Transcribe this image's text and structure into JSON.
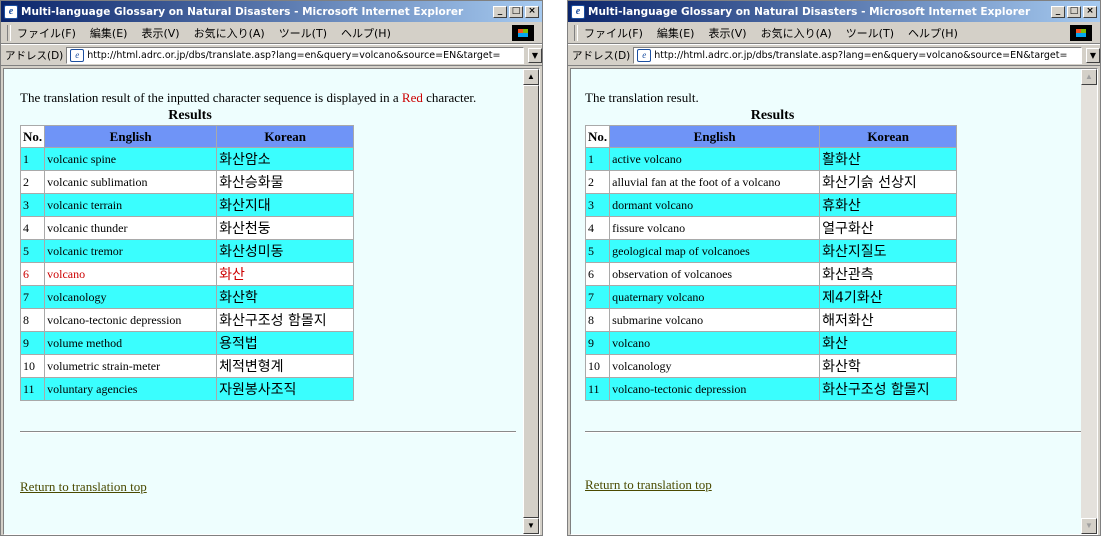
{
  "windows": [
    {
      "title": "Multi-language Glossary on Natural Disasters - Microsoft Internet Explorer",
      "menu": [
        "ファイル(F)",
        "編集(E)",
        "表示(V)",
        "お気に入り(A)",
        "ツール(T)",
        "ヘルプ(H)"
      ],
      "address_label": "アドレス(D)",
      "url": "http://html.adrc.or.jp/dbs/translate.asp?lang=en&query=volcano&source=EN&target=",
      "intro_before": "The translation result of the inputted character sequence is displayed in a ",
      "intro_red": "Red",
      "intro_after": " character.",
      "results_title": "Results",
      "headers": [
        "No.",
        "English",
        "Korean"
      ],
      "rows": [
        {
          "no": "1",
          "english": "volcanic spine",
          "korean": "화산암소"
        },
        {
          "no": "2",
          "english": "volcanic sublimation",
          "korean": "화산승화물"
        },
        {
          "no": "3",
          "english": "volcanic terrain",
          "korean": "화산지대"
        },
        {
          "no": "4",
          "english": "volcanic thunder",
          "korean": "화산천둥"
        },
        {
          "no": "5",
          "english": "volcanic tremor",
          "korean": "화산성미동"
        },
        {
          "no": "6",
          "english": "volcano",
          "korean": "화산"
        },
        {
          "no": "7",
          "english": "volcanology",
          "korean": "화산학"
        },
        {
          "no": "8",
          "english": "volcano-tectonic depression",
          "korean": "화산구조성 함몰지"
        },
        {
          "no": "9",
          "english": "volume method",
          "korean": "용적법"
        },
        {
          "no": "10",
          "english": "volumetric strain-meter",
          "korean": "체적변형계"
        },
        {
          "no": "11",
          "english": "voluntary agencies",
          "korean": "자원봉사조직"
        }
      ],
      "return_link": "Return to translation top"
    },
    {
      "title": "Multi-language Glossary on Natural Disasters - Microsoft Internet Explorer",
      "menu": [
        "ファイル(F)",
        "編集(E)",
        "表示(V)",
        "お気に入り(A)",
        "ツール(T)",
        "ヘルプ(H)"
      ],
      "address_label": "アドレス(D)",
      "url": "http://html.adrc.or.jp/dbs/translate.asp?lang=en&query=volcano&source=EN&target=",
      "intro": "The translation result.",
      "results_title": "Results",
      "headers": [
        "No.",
        "English",
        "Korean"
      ],
      "rows": [
        {
          "no": "1",
          "english": "active volcano",
          "korean": "활화산"
        },
        {
          "no": "2",
          "english": "alluvial fan at the foot of a volcano",
          "korean": "화산기슭 선상지"
        },
        {
          "no": "3",
          "english": "dormant volcano",
          "korean": "휴화산"
        },
        {
          "no": "4",
          "english": "fissure volcano",
          "korean": "열구화산"
        },
        {
          "no": "5",
          "english": "geological map of volcanoes",
          "korean": "화산지질도"
        },
        {
          "no": "6",
          "english": "observation of volcanoes",
          "korean": "화산관측"
        },
        {
          "no": "7",
          "english": "quaternary volcano",
          "korean": "제4기화산"
        },
        {
          "no": "8",
          "english": "submarine volcano",
          "korean": "해저화산"
        },
        {
          "no": "9",
          "english": "volcano",
          "korean": "화산"
        },
        {
          "no": "10",
          "english": "volcanology",
          "korean": "화산학"
        },
        {
          "no": "11",
          "english": "volcano-tectonic depression",
          "korean": "화산구조성 함몰지"
        }
      ],
      "return_link": "Return to translation top"
    }
  ],
  "colors": {
    "header_bg": "#6f94f7",
    "alt_row_bg": "#3afefe",
    "highlight_text": "#cc0000",
    "page_bg": "#eefefe"
  },
  "highlighted_row_left": "6"
}
